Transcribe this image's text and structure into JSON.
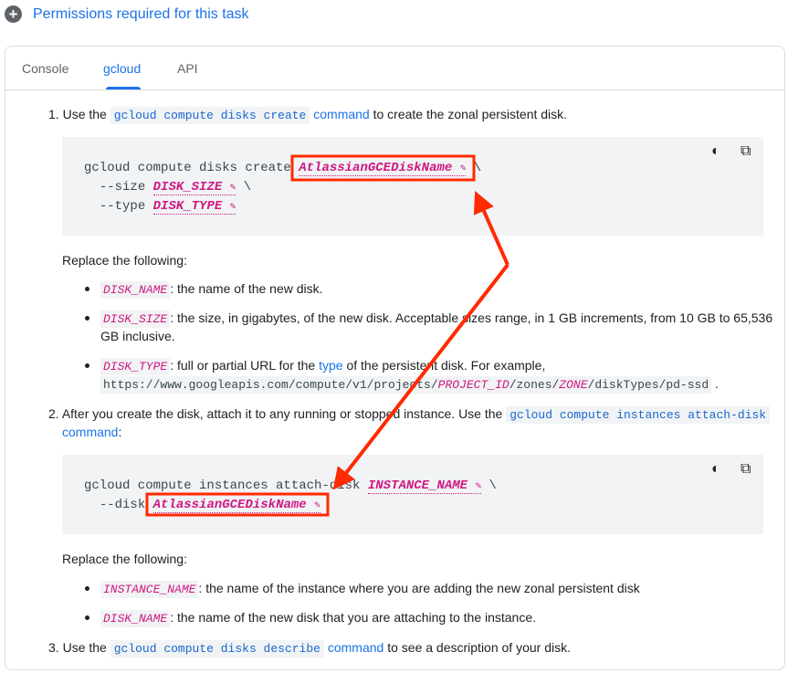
{
  "header": {
    "title": "Permissions required for this task",
    "icon": "plus-circle-icon"
  },
  "tabs": [
    {
      "label": "Console"
    },
    {
      "label": "gcloud",
      "active": true
    },
    {
      "label": "API"
    }
  ],
  "step1": {
    "num": "1.",
    "pre": "Use the",
    "code": "gcloud compute disks create",
    "link": "command",
    "post": "to create the zonal persistent disk."
  },
  "code1": {
    "cmd": "gcloud compute disks create",
    "name": "AtlassianGCEDiskName",
    "l2": "--size",
    "size": "DISK_SIZE",
    "l3": "--type",
    "type": "DISK_TYPE",
    "bs": "\\"
  },
  "replace": "Replace the following:",
  "b1": {
    "var": "DISK_NAME",
    "text": ": the name of the new disk."
  },
  "b2": {
    "var": "DISK_SIZE",
    "text": ": the size, in gigabytes, of the new disk. Acceptable sizes range, in 1 GB increments, from 10 GB to 65,536",
    "text2": "GB inclusive."
  },
  "b3": {
    "var": "DISK_TYPE",
    "text": ": full or partial URL for the",
    "link": "type",
    "text_b": "of the persistent disk. For example,",
    "u1": "https://www.googleapis.com/compute/v1/projects/",
    "u2": "PROJECT_ID",
    "u3": "/zones/",
    "u4": "ZONE",
    "u5": "/diskTypes/pd-ssd",
    "dot": "."
  },
  "step2": {
    "num": "2.",
    "pre": "After you create the disk, attach it to any running or stopped instance. Use the",
    "code": "gcloud compute instances attach-disk",
    "link": "command",
    "colon": ":"
  },
  "code2": {
    "cmd": "gcloud compute instances attach-disk",
    "inst": "INSTANCE_NAME",
    "l2": "--disk",
    "name": "AtlassianGCEDiskName",
    "bs": "\\"
  },
  "b4": {
    "var": "INSTANCE_NAME",
    "text": ": the name of the instance where you are adding the new zonal persistent disk"
  },
  "b5": {
    "var": "DISK_NAME",
    "text": ": the name of the new disk that you are attaching to the instance."
  },
  "step3": {
    "num": "3.",
    "pre": "Use the",
    "code": "gcloud compute disks describe",
    "link": "command",
    "post": "to see a description of your disk."
  },
  "icons": {
    "theme": "dark-mode-toggle-icon",
    "copy": "copy-icon",
    "edit": "pencil-icon"
  },
  "colors": {
    "accent": "#1a73e8",
    "var": "#d01884",
    "annotation": "#ff2a00"
  }
}
